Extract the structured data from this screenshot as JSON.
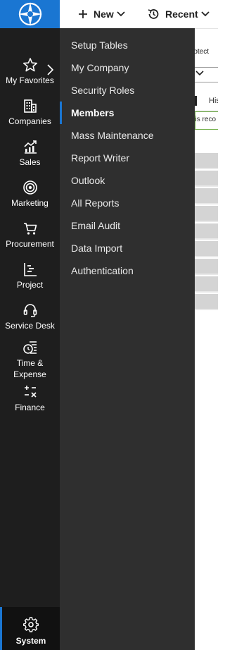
{
  "colors": {
    "brand": "#1a76d2",
    "nav_bg": "#1e1e1e",
    "submenu_bg": "#2f2f2f"
  },
  "topbar": {
    "logo_icon": "compass-logo-icon",
    "new_label": "New",
    "recent_label": "Recent"
  },
  "nav": {
    "collapse_icon": "chevron-right-icon",
    "items": [
      {
        "label": "My Favorites",
        "icon": "star-icon"
      },
      {
        "label": "Companies",
        "icon": "building-icon"
      },
      {
        "label": "Sales",
        "icon": "chart-up-icon"
      },
      {
        "label": "Marketing",
        "icon": "target-icon"
      },
      {
        "label": "Procurement",
        "icon": "cart-icon"
      },
      {
        "label": "Project",
        "icon": "project-chart-icon"
      },
      {
        "label": "Service Desk",
        "icon": "headset-icon"
      },
      {
        "label_line1": "Time &",
        "label_line2": "Expense",
        "icon": "clock-list-icon"
      },
      {
        "label": "Finance",
        "icon": "calculator-icon"
      }
    ],
    "system_label": "System"
  },
  "submenu": {
    "items": [
      "Setup Tables",
      "My Company",
      "Security Roles",
      "Members",
      "Mass Maintenance",
      "Report Writer",
      "Outlook",
      "All Reports",
      "Email Audit",
      "Data Import",
      "Authentication"
    ],
    "active": "Members"
  },
  "background_page": {
    "protect_text": "rotect",
    "tab_text": "His",
    "note_text": "his reco"
  }
}
